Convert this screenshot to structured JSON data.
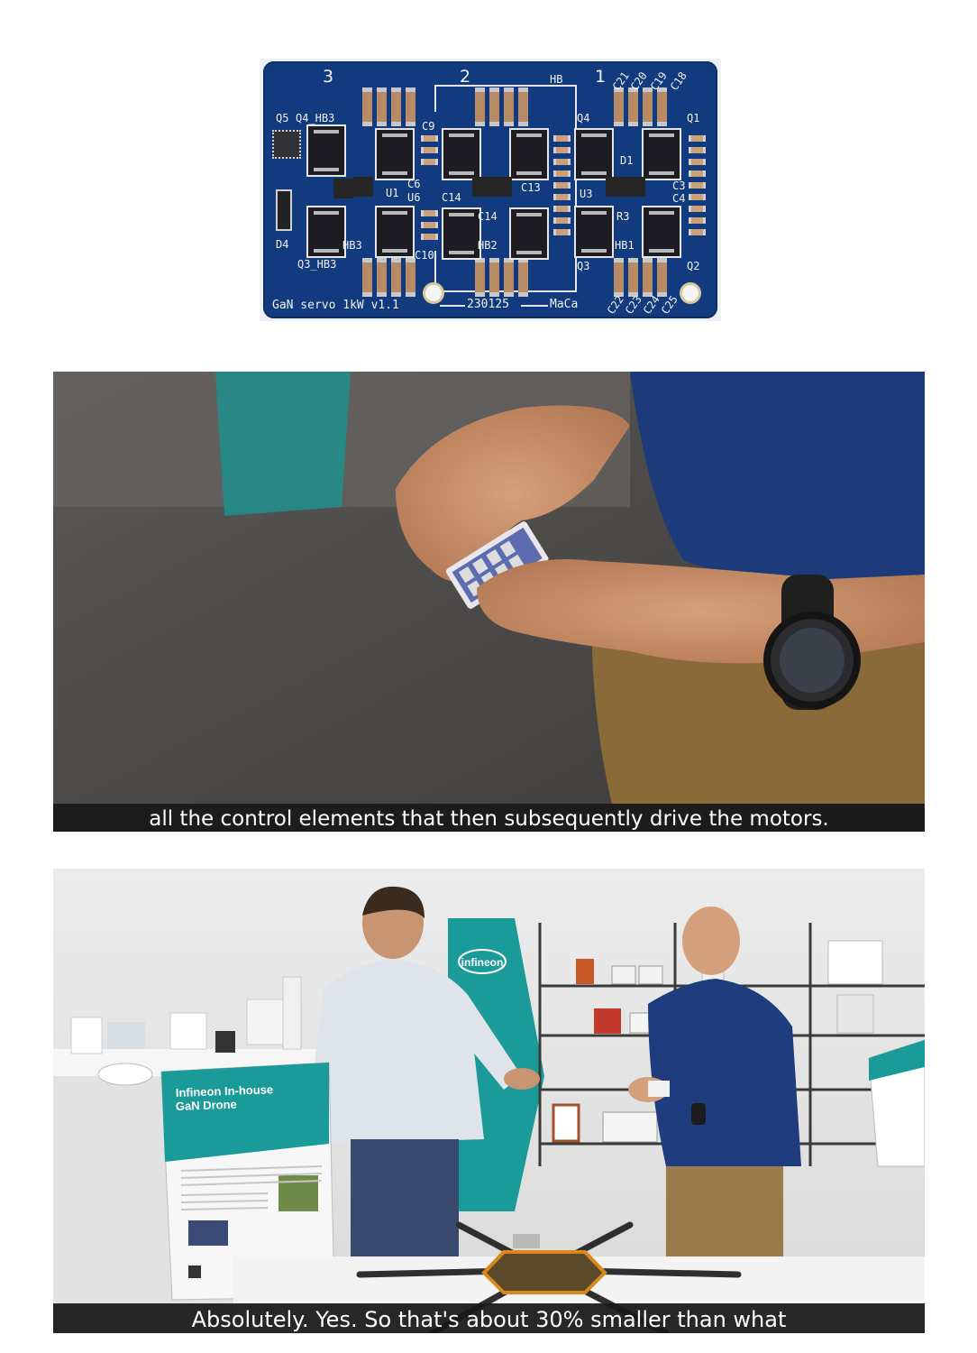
{
  "pcb": {
    "board_label": "GaN servo 1kW v1.1",
    "date_code": "230125",
    "author": "MaCa",
    "phase_1": "1",
    "phase_2": "2",
    "phase_3": "3",
    "hb_label": "HB",
    "half_bridges": [
      "HB1",
      "HB2",
      "HB3"
    ],
    "refdes": {
      "q5": "Q5",
      "q4_hb3": "Q4_HB3",
      "q3_hb3": "Q3_HB3",
      "d4": "D4",
      "c9": "C9",
      "c10": "C10",
      "c6": "C6",
      "u1": "U1",
      "u6": "U6",
      "c14a": "C14",
      "c14b": "C14",
      "c13": "C13",
      "q4": "Q4",
      "q3": "Q3",
      "d1": "D1",
      "u3": "U3",
      "r3": "R3",
      "c3": "C3",
      "c4": "C4",
      "q1": "Q1",
      "q2": "Q2",
      "c21": "C21",
      "c20": "C20",
      "c19": "C19",
      "c18": "C18",
      "c22": "C22",
      "c23": "C23",
      "c24": "C24",
      "c25": "C25"
    }
  },
  "video_frames": [
    {
      "subtitle": "all the control elements that then subsequently drive the motors."
    },
    {
      "subtitle": "Absolutely. Yes. So that's about 30% smaller than what",
      "poster": {
        "title_line1": "Infineon In-house",
        "title_line2": "GaN Drone"
      },
      "brand": "infineon"
    }
  ],
  "colors": {
    "pcb_soldermask": "#123a7e",
    "infineon_teal": "#1b9a9a",
    "subtitle_bar": "#1a1a1a"
  }
}
